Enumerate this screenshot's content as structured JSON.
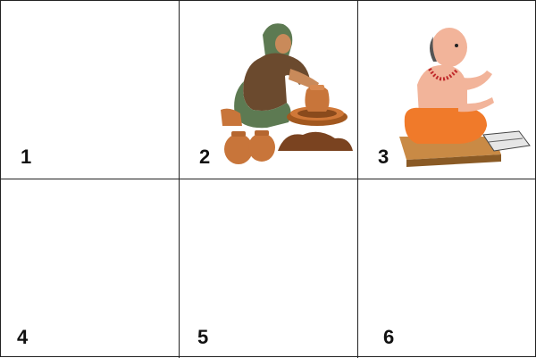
{
  "cells": [
    {
      "label": "1",
      "image": "empty"
    },
    {
      "label": "2",
      "image": "potter-woman-at-wheel-icon"
    },
    {
      "label": "3",
      "image": "priest-teaching-icon"
    },
    {
      "label": "4",
      "image": "empty"
    },
    {
      "label": "5",
      "image": "empty"
    },
    {
      "label": "6",
      "image": "empty"
    }
  ],
  "colors": {
    "grid": "#222222",
    "clay": "#c8753a",
    "saffron": "#f07a2a",
    "skin": "#f2b49a",
    "sari_green": "#5d7a52"
  }
}
